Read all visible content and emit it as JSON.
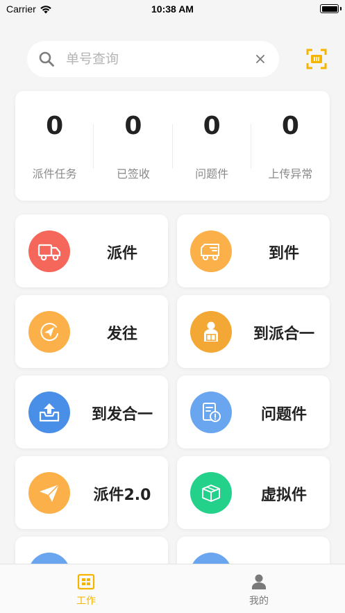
{
  "status_bar": {
    "carrier": "Carrier",
    "time": "10:38 AM",
    "battery_level": 1.0
  },
  "search": {
    "placeholder": "单号查询",
    "value": ""
  },
  "stats": [
    {
      "value": "0",
      "label": "派件任务"
    },
    {
      "value": "0",
      "label": "已签收"
    },
    {
      "value": "0",
      "label": "问题件"
    },
    {
      "value": "0",
      "label": "上传异常"
    }
  ],
  "menu": [
    {
      "label": "派件",
      "icon": "delivery-truck-icon",
      "color": "#f4675a"
    },
    {
      "label": "到件",
      "icon": "arrival-truck-icon",
      "color": "#fbb04a"
    },
    {
      "label": "发往",
      "icon": "send-plane-icon",
      "color": "#fbb04a"
    },
    {
      "label": "到派合一",
      "icon": "courier-box-icon",
      "color": "#f3a835"
    },
    {
      "label": "到发合一",
      "icon": "upload-tray-icon",
      "color": "#4a8fe7"
    },
    {
      "label": "问题件",
      "icon": "problem-document-icon",
      "color": "#6aa6f0"
    },
    {
      "label": "派件2.0",
      "icon": "paper-plane-icon",
      "color": "#fbb04a"
    },
    {
      "label": "虚拟件",
      "icon": "virtual-package-icon",
      "color": "#23d18b"
    }
  ],
  "tabs": [
    {
      "label": "工作",
      "icon": "workbench-icon",
      "active": true
    },
    {
      "label": "我的",
      "icon": "person-icon",
      "active": false
    }
  ],
  "colors": {
    "accent": "#f5b400",
    "background": "#f5f5f5",
    "inactive_tab": "#7a7a7a"
  }
}
